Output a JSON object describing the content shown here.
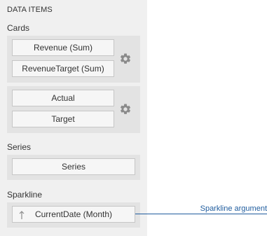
{
  "panel": {
    "title": "DATA ITEMS",
    "cards": {
      "label": "Cards",
      "groups": [
        {
          "items": [
            "Revenue (Sum)",
            "RevenueTarget (Sum)"
          ],
          "options_icon": "gear-icon"
        },
        {
          "items": [
            "Actual",
            "Target"
          ],
          "options_icon": "gear-icon"
        }
      ]
    },
    "series": {
      "label": "Series",
      "item": "Series"
    },
    "sparkline": {
      "label": "Sparkline",
      "item": "CurrentDate (Month)",
      "sort_icon": "sort-ascending-arrow-icon"
    }
  },
  "annotation": {
    "text": "Sparkline argument",
    "color": "#1f5c9e"
  }
}
